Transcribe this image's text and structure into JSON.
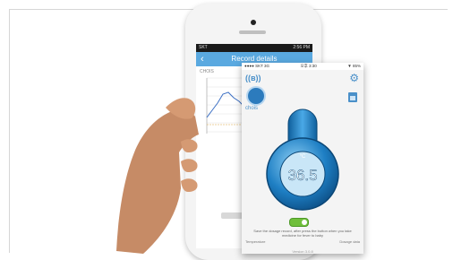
{
  "back_phone": {
    "status_left": "SKT",
    "status_right": "2:56 PM",
    "nav_title": "Record details",
    "back_icon": "chevron-left",
    "chart_name": "CHOIS"
  },
  "front_phone": {
    "status_left": "●●●● SKT 3G",
    "status_center": "오후 3:30",
    "status_right": "▼ 85%",
    "user_name": "chois",
    "temp_unit": "°C",
    "temperature": "36.5",
    "instruction": "Save the dosage record, after press the button when you take medicine for fever to baby",
    "row_left": "Temperature",
    "row_right": "Dosage data",
    "version": "Version 3.0.8",
    "colors": {
      "accent": "#4a90c9",
      "toggle_on": "#6fbf3b"
    }
  }
}
